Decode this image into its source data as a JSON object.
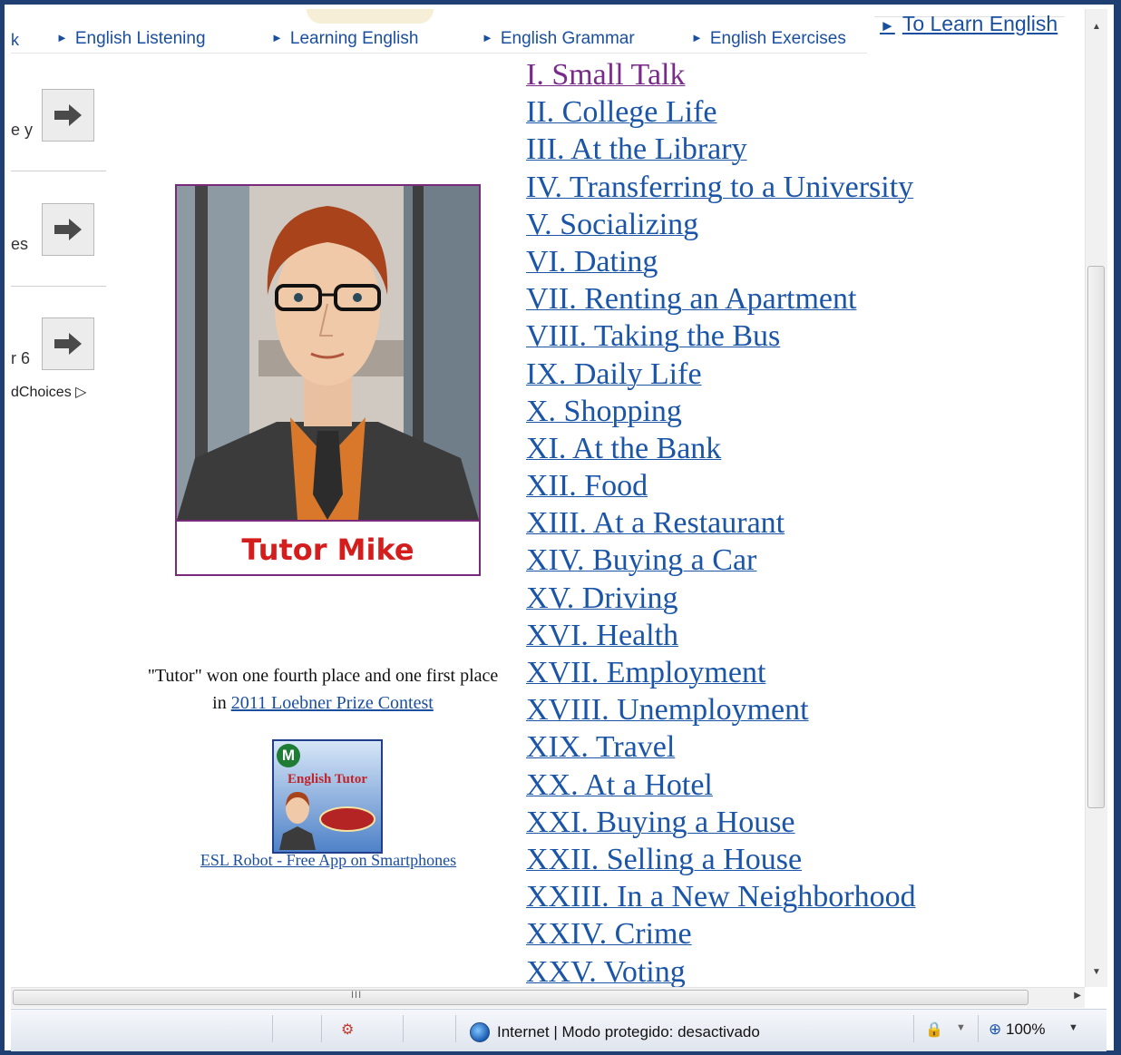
{
  "nav": {
    "fragment": "k",
    "links": [
      "English Listening",
      "Learning English",
      "English Grammar",
      "English Exercises"
    ],
    "triangle": "►",
    "to_learn": "To Learn English"
  },
  "ads": {
    "rows": [
      {
        "text": "e y",
        "icon": "arrow-right-icon"
      },
      {
        "text": "es",
        "icon": "arrow-right-icon"
      },
      {
        "text": "r 6",
        "icon": "arrow-right-icon"
      }
    ],
    "adchoices": "dChoices"
  },
  "tutor": {
    "name": "Tutor Mike"
  },
  "caption": {
    "line1": "\"Tutor\" won one fourth place and one first place",
    "line2_prefix": "in",
    "link": "2011 Loebner Prize Contest"
  },
  "app": {
    "logo_letter": "M",
    "box_title": "English Tutor",
    "link": "ESL Robot - Free App on Smartphones"
  },
  "lessons": [
    "I. Small Talk",
    "II. College Life",
    "III. At the Library",
    "IV. Transferring to a University",
    "V. Socializing",
    "VI. Dating",
    "VII. Renting an Apartment",
    "VIII. Taking the Bus",
    "IX. Daily Life",
    "X. Shopping",
    "XI. At the Bank",
    "XII. Food",
    "XIII. At a Restaurant",
    "XIV. Buying a Car",
    "XV. Driving",
    "XVI. Health",
    "XVII. Employment",
    "XVIII. Unemployment",
    "XIX. Travel",
    "XX. At a Hotel",
    "XXI. Buying a House",
    "XXII. Selling a House",
    "XXIII. In a New Neighborhood",
    "XXIV. Crime",
    "XXV. Voting"
  ],
  "statusbar": {
    "zone": "Internet | Modo protegido: desactivado",
    "zoom": "100%"
  },
  "colors": {
    "link": "#1a55a8",
    "visited": "#7a2a8a",
    "tutor_name": "#d41e1e",
    "frame": "#1f3f73"
  }
}
